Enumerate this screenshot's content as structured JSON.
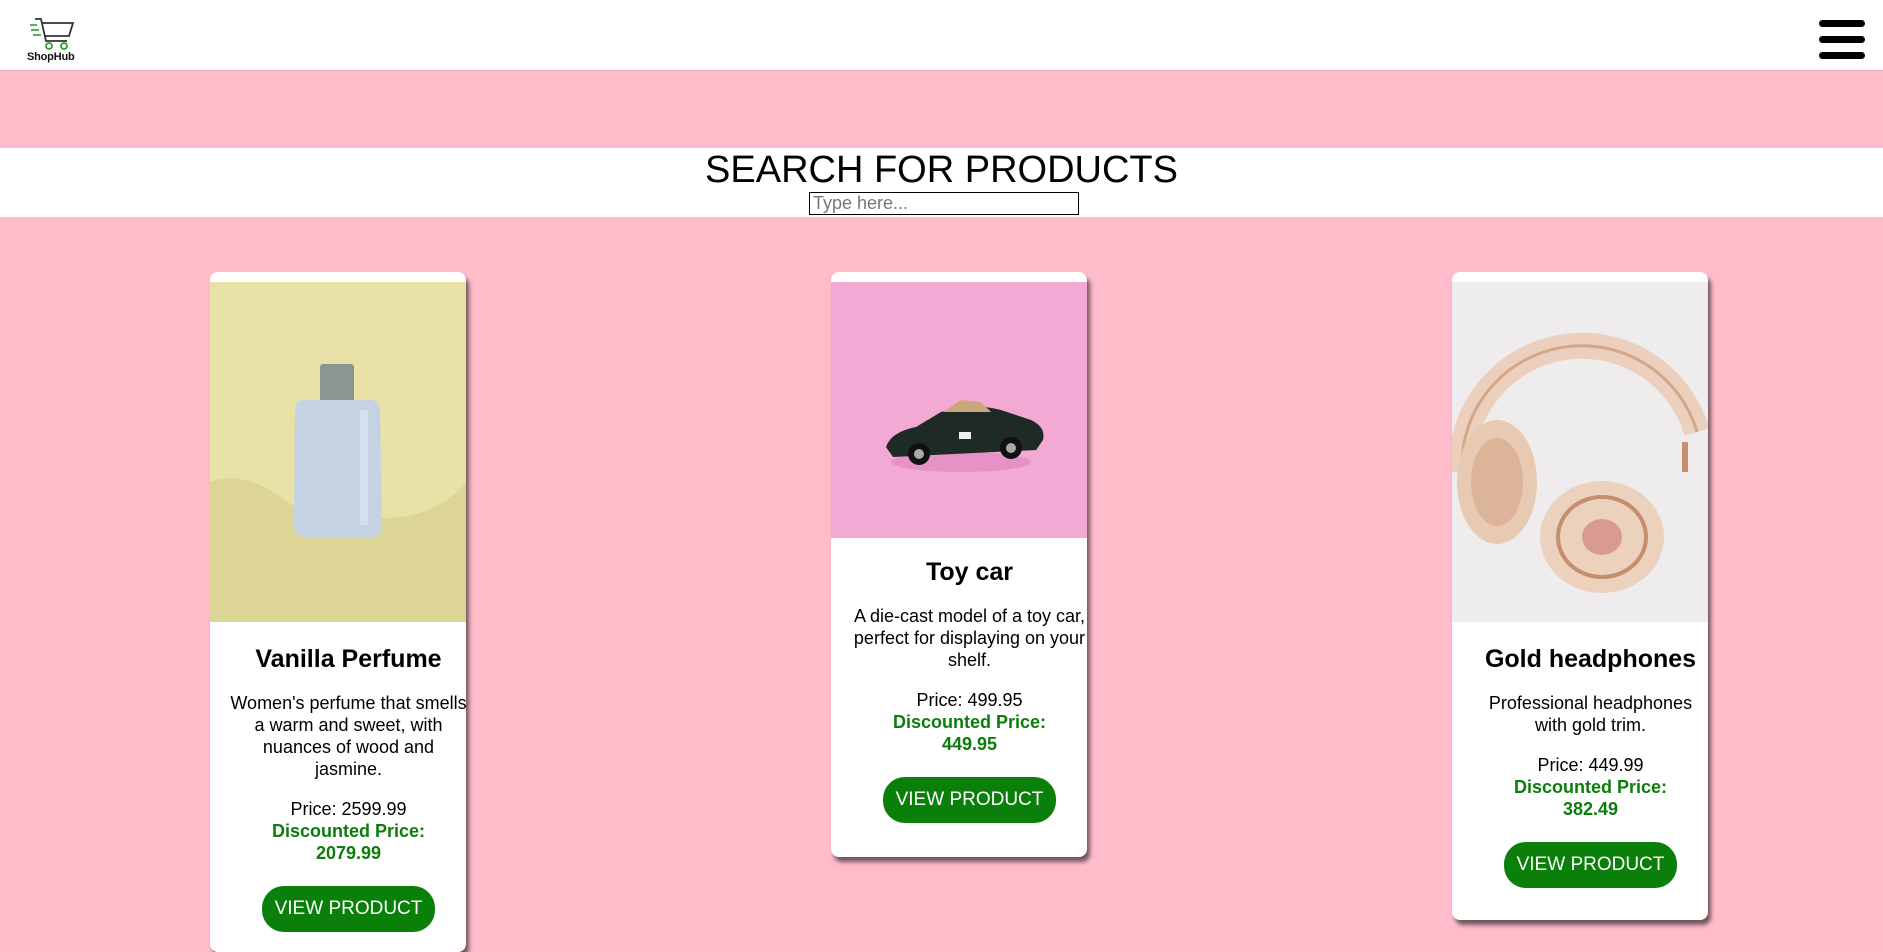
{
  "header": {
    "logo_text": "ShopHub",
    "accent": "#2aa02a"
  },
  "search": {
    "title": "SEARCH FOR PRODUCTS",
    "placeholder": "Type here..."
  },
  "colors": {
    "background": "#ffbccb",
    "discount": "#0c7d0c",
    "button": "#0a7f0a"
  },
  "products": [
    {
      "name": "Vanilla Perfume",
      "description": "Women's perfume that smells a warm and sweet, with nuances of wood and jasmine.",
      "price": "Price: 2599.99",
      "discount_label": "Discounted Price:",
      "discount_value": "2079.99",
      "button": "VIEW PRODUCT",
      "image_icon": "perfume-bottle-image"
    },
    {
      "name": "Toy car",
      "description": "A die-cast model of a toy car, perfect for displaying on your shelf.",
      "price": "Price: 499.95",
      "discount_label": "Discounted Price:",
      "discount_value": "449.95",
      "button": "VIEW PRODUCT",
      "image_icon": "toy-car-image"
    },
    {
      "name": "Gold headphones",
      "description": "Professional headphones with gold trim.",
      "price": "Price: 449.99",
      "discount_label": "Discounted Price:",
      "discount_value": "382.49",
      "button": "VIEW PRODUCT",
      "image_icon": "headphones-image"
    }
  ]
}
